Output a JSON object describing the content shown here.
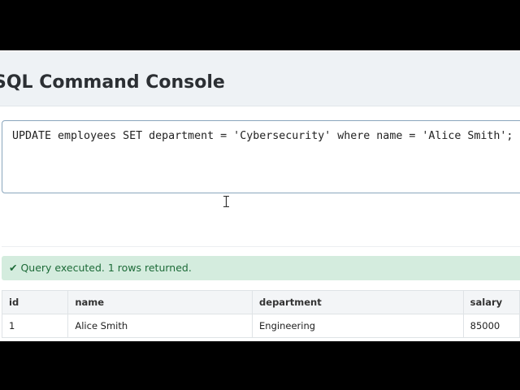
{
  "page": {
    "title": "SQL Command Console"
  },
  "editor": {
    "query": "UPDATE employees SET department = 'Cybersecurity' where name = 'Alice Smith';"
  },
  "status": {
    "icon": "check-icon",
    "text": "✔ Query executed. 1 rows returned.",
    "color": "#1d6b38",
    "background": "#d4ecde"
  },
  "results": {
    "columns": [
      "id",
      "name",
      "department",
      "salary"
    ],
    "rows": [
      [
        "1",
        "Alice Smith",
        "Engineering",
        "85000"
      ]
    ]
  }
}
